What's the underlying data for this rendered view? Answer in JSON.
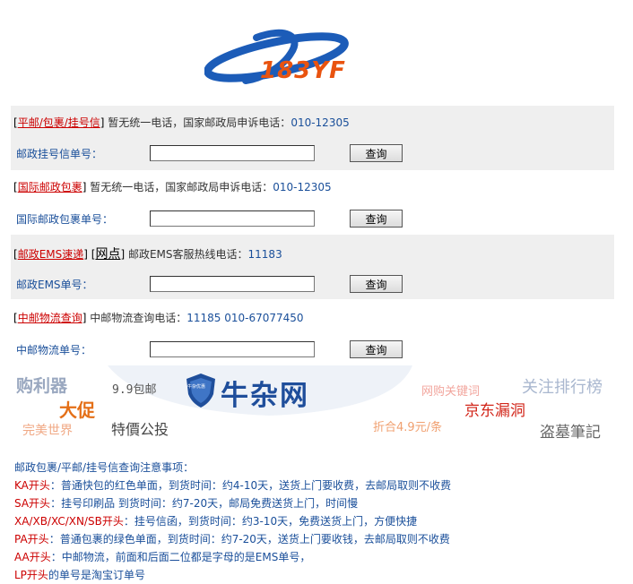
{
  "logo": {
    "text": "183YF"
  },
  "sections": [
    {
      "link": "平邮/包裹/挂号信",
      "note": "暂无统一电话，国家邮政局申诉电话：",
      "phone": "010-12305",
      "label": "邮政挂号信单号：",
      "value": "",
      "button": "查询"
    },
    {
      "link": "国际邮政包裹",
      "note": "暂无统一电话，国家邮政局申诉电话：",
      "phone": "010-12305",
      "label": "国际邮政包裹单号：",
      "value": "",
      "button": "查询"
    },
    {
      "link": "邮政EMS速递",
      "extra_link": "网点",
      "note": "邮政EMS客服热线电话：",
      "phone": "11183",
      "label": "邮政EMS单号：",
      "value": "",
      "button": "查询"
    },
    {
      "link": "中邮物流查询",
      "note": "中邮物流查询电话：",
      "phone": "11185 010-67077450",
      "label": "中邮物流单号：",
      "value": "",
      "button": "查询"
    }
  ],
  "ad": {
    "items": [
      "购利器",
      "9.9包邮",
      "牛杂网",
      "网购关键词",
      "关注排行榜",
      "大促",
      "京东漏洞",
      "完美世界",
      "特價公投",
      "折合4.9元/条",
      "盗墓筆記"
    ],
    "shield_text": "牛杂优惠",
    "colors": {
      "blue": "#1f4e9b",
      "red": "#d2261a",
      "orange": "#e46f17",
      "gray": "#666666"
    }
  },
  "notes": {
    "heading": "邮政包裹/平邮/挂号信查询注意事项：",
    "rows": [
      {
        "key": "KA开头",
        "text": "：普通快包的红色单面，到货时间：约4-10天，送货上门要收费，去邮局取则不收费"
      },
      {
        "key": "SA开头",
        "text": "：挂号印刷品 到货时间：约7-20天，邮局免费送货上门，时间慢"
      },
      {
        "key": "XA/XB/XC/XN/SB开头",
        "text": "：挂号信函，到货时间：约3-10天，免费送货上门，方便快捷"
      },
      {
        "key": "PA开头",
        "text": "：普通包裹的绿色单面，到货时间：约7-20天，送货上门要收钱，去邮局取则不收费"
      },
      {
        "key": "AA开头",
        "text": "：中邮物流，前面和后面二位都是字母的是EMS单号，"
      },
      {
        "key": "LP开头",
        "text": "的单号是淘宝订单号"
      }
    ]
  },
  "colors": {
    "accent_red": "#cc0000",
    "text_blue": "#1a4f9a",
    "logo_blue": "#1c5cb8",
    "logo_orange": "#e9530f"
  }
}
